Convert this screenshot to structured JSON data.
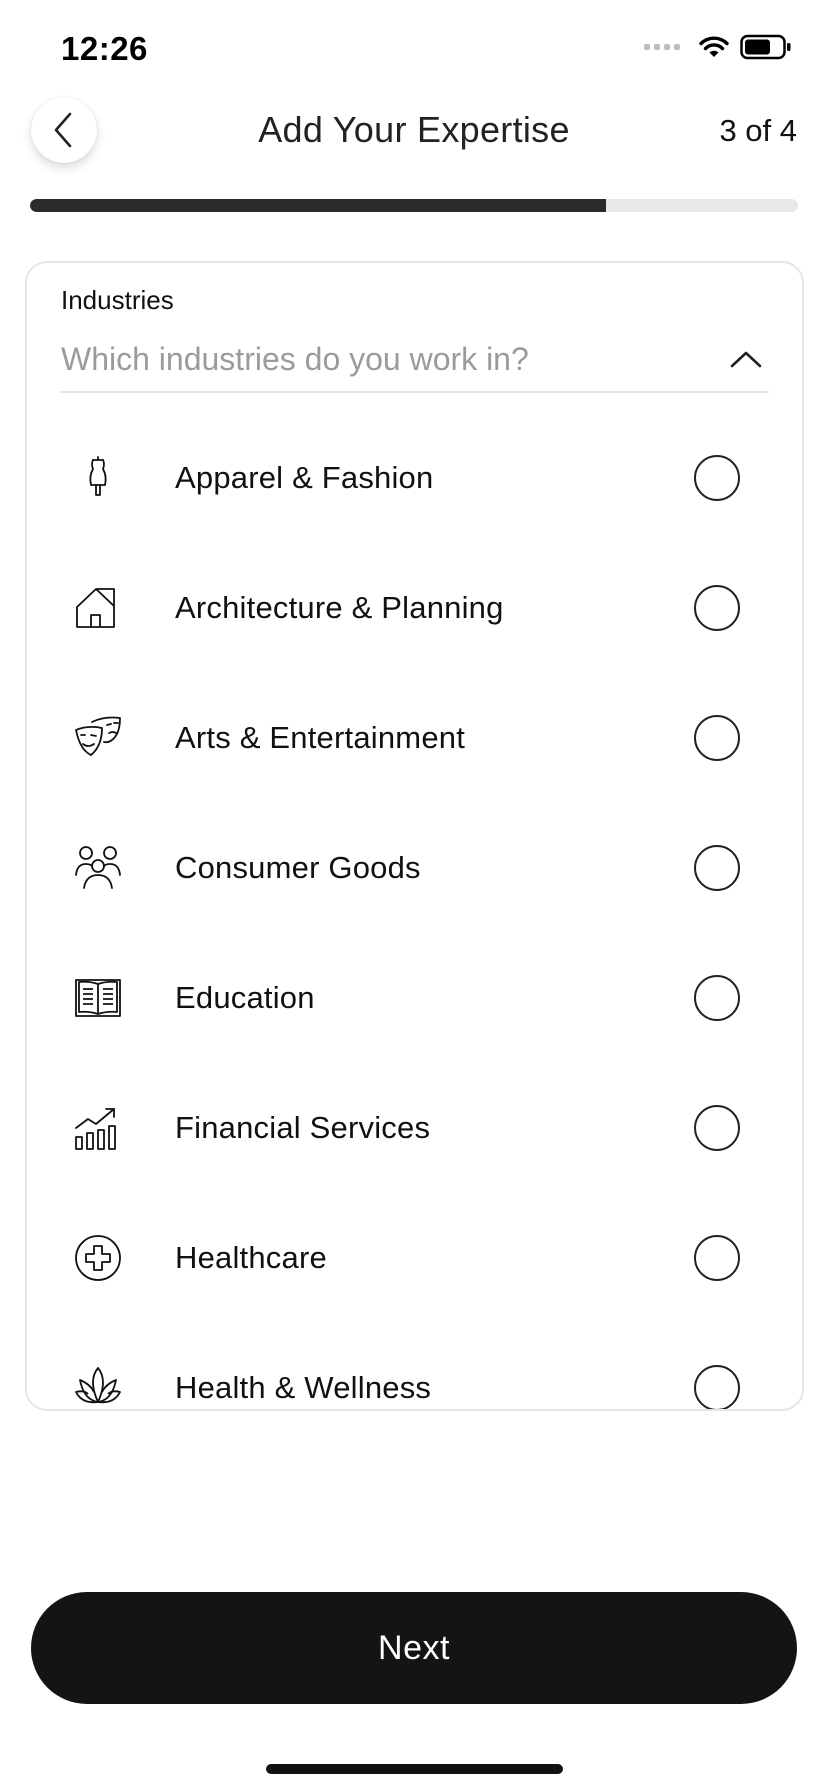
{
  "status_bar": {
    "time": "12:26"
  },
  "header": {
    "title": "Add Your Expertise",
    "step": "3 of 4",
    "progress": 0.75
  },
  "industries": {
    "label": "Industries",
    "placeholder": "Which industries do you work in?",
    "items": [
      {
        "label": "Apparel & Fashion",
        "icon": "dress-form-icon"
      },
      {
        "label": "Architecture & Planning",
        "icon": "house-icon"
      },
      {
        "label": "Arts & Entertainment",
        "icon": "theater-masks-icon"
      },
      {
        "label": "Consumer Goods",
        "icon": "people-icon"
      },
      {
        "label": "Education",
        "icon": "open-book-icon"
      },
      {
        "label": "Financial Services",
        "icon": "growth-chart-icon"
      },
      {
        "label": "Healthcare",
        "icon": "medical-cross-icon"
      },
      {
        "label": "Health & Wellness",
        "icon": "lotus-icon"
      }
    ]
  },
  "footer": {
    "next_label": "Next"
  },
  "colors": {
    "primary": "#141414",
    "progress_track": "#e8e8e8",
    "placeholder": "#9b9b9b"
  }
}
